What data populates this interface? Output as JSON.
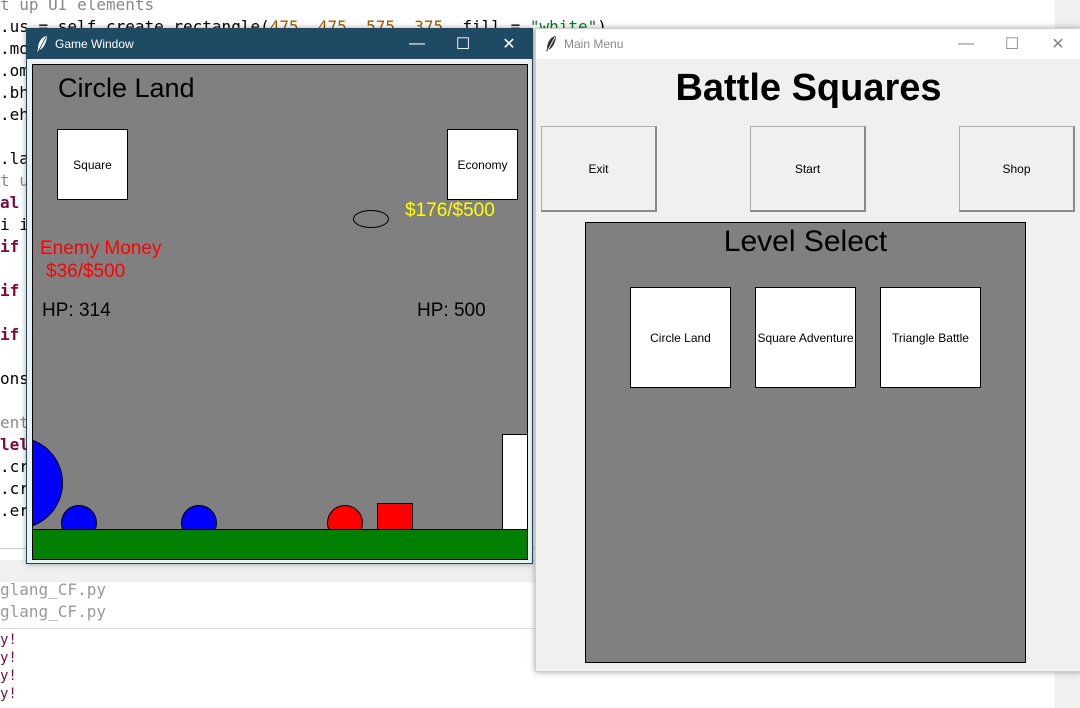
{
  "editor": {
    "code_lines": [
      {
        "text": "t up UI elements",
        "cls": "dim"
      },
      {
        "text": ".us = self.create_rectangle(475, 475, 575, 375, fill = \"white\")"
      },
      {
        "text": ".mo"
      },
      {
        "text": ".om"
      },
      {
        "text": ".bh"
      },
      {
        "text": ".eh"
      },
      {
        "text": ""
      },
      {
        "text": ".la"
      },
      {
        "text": "t u",
        "cls": "dim"
      },
      {
        "text": "al",
        "cls": "kw"
      },
      {
        "text": "i i"
      },
      {
        "text": "if",
        "cls": "kw"
      },
      {
        "text": ""
      },
      {
        "text": "if",
        "cls": "kw"
      },
      {
        "text": ""
      },
      {
        "text": "if",
        "cls": "kw"
      },
      {
        "text": ""
      },
      {
        "text": "ons"
      },
      {
        "text": ""
      },
      {
        "text": "ent",
        "cls": "dim"
      },
      {
        "text": "lel",
        "cls": "kw"
      },
      {
        "text": ".cr"
      },
      {
        "text": ".cr"
      },
      {
        "text": ".er"
      }
    ],
    "shell_files": [
      "glang_CF.py",
      "glang_CF.py"
    ],
    "shell_out": [
      "y!",
      "y!",
      "y!",
      "y!"
    ]
  },
  "game_window": {
    "title": "Game Window",
    "minimize_glyph": "—",
    "maximize_glyph": "☐",
    "close_glyph": "✕",
    "level_name": "Circle Land",
    "square_button": "Square",
    "economy_button": "Economy",
    "player_money": "$176/$500",
    "enemy_money_label": "Enemy Money",
    "enemy_money": "$36/$500",
    "enemy_hp": "HP: 314",
    "player_hp": "HP: 500",
    "colors": {
      "canvas_bg": "#808080",
      "ground": "#008000",
      "enemy_unit": "#0000ff",
      "player_unit": "#ff0000",
      "player_money": "#ffff00",
      "enemy_money": "#ff0000"
    }
  },
  "menu_window": {
    "title": "Main Menu",
    "minimize_glyph": "—",
    "maximize_glyph": "☐",
    "close_glyph": "✕",
    "heading": "Battle Squares",
    "buttons": {
      "exit": "Exit",
      "start": "Start",
      "shop": "Shop"
    },
    "level_select_title": "Level Select",
    "levels": [
      "Circle Land",
      "Square Adventure",
      "Triangle Battle"
    ]
  }
}
